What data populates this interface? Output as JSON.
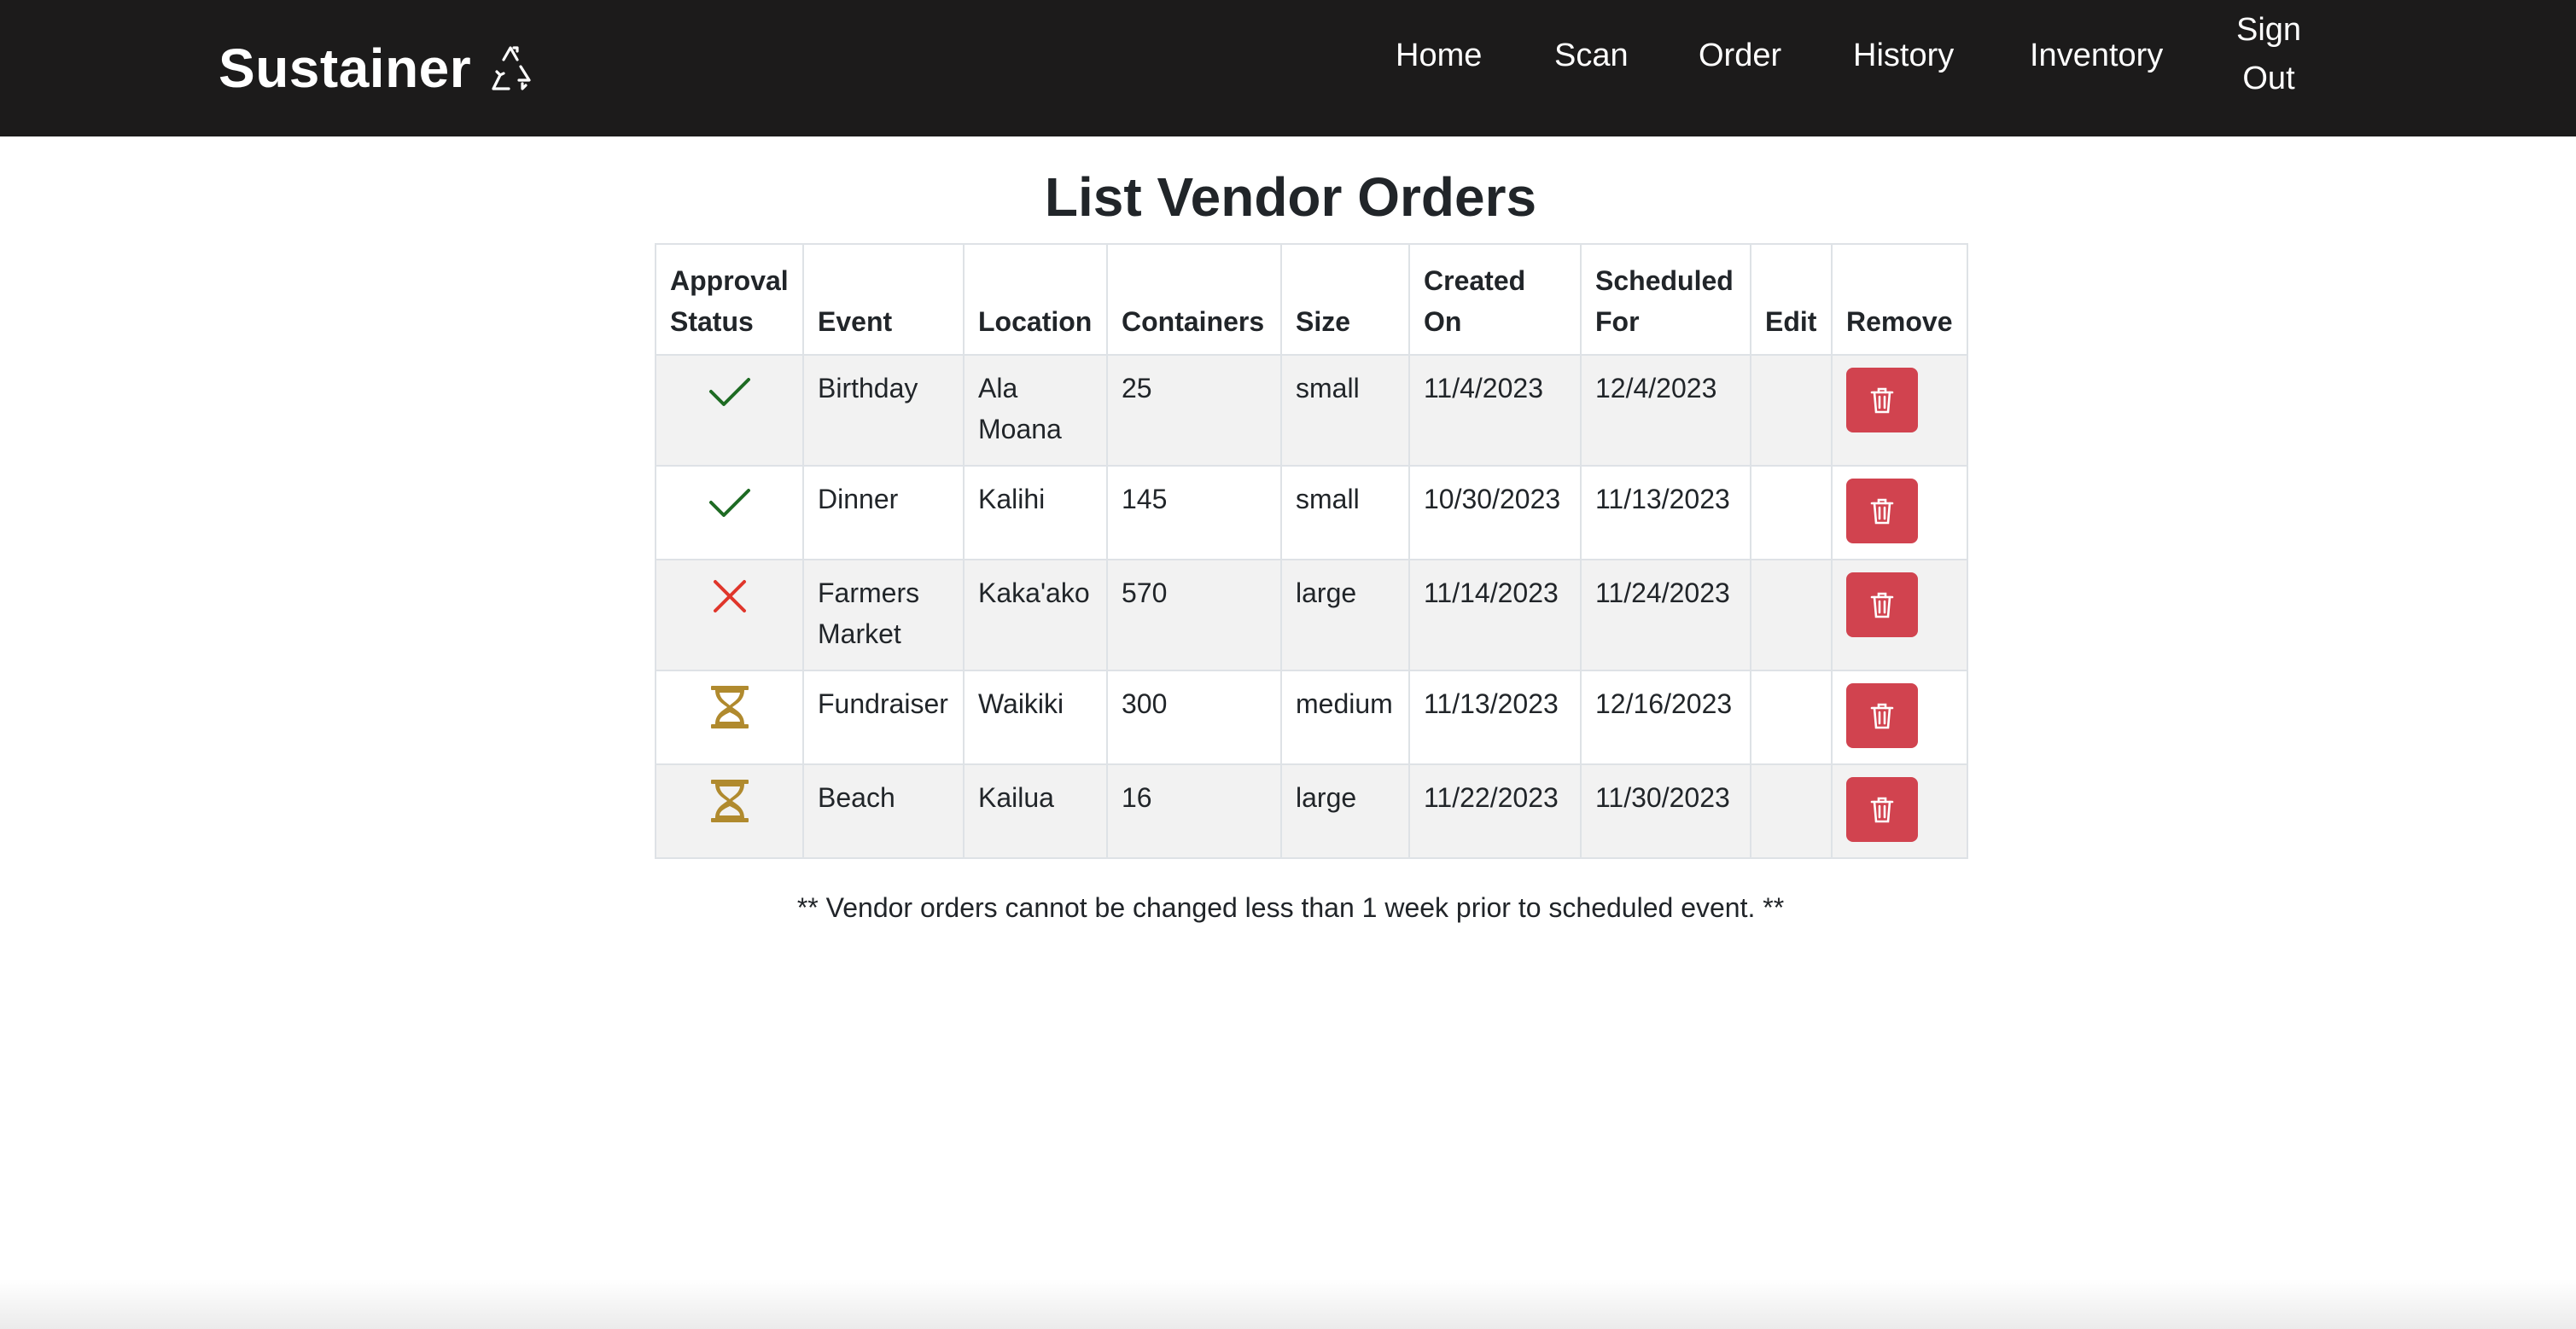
{
  "navbar": {
    "brand": "Sustainer",
    "brand_icon": "recycle-icon",
    "links": {
      "home": "Home",
      "scan": "Scan",
      "order": "Order",
      "history": "History",
      "inventory": "Inventory"
    },
    "signout_line1": "Sign",
    "signout_line2": "Out",
    "background": "#1c1b1b"
  },
  "page": {
    "title": "List Vendor Orders",
    "footnote": "** Vendor orders cannot be changed less than 1 week prior to scheduled event. **"
  },
  "table": {
    "headers": {
      "approval_line1": "Approval",
      "approval_line2": "Status",
      "event": "Event",
      "location": "Location",
      "containers": "Containers",
      "size": "Size",
      "created_line1": "Created",
      "created_line2": "On",
      "scheduled_line1": "Scheduled",
      "scheduled_line2": "For",
      "edit": "Edit",
      "remove": "Remove"
    },
    "rows": [
      {
        "status": "approved",
        "status_icon": "check-icon",
        "event": "Birthday",
        "location": "Ala Moana",
        "containers": "25",
        "size": "small",
        "created": "11/4/2023",
        "scheduled": "12/4/2023"
      },
      {
        "status": "approved",
        "status_icon": "check-icon",
        "event": "Dinner",
        "location": "Kalihi",
        "containers": "145",
        "size": "small",
        "created": "10/30/2023",
        "scheduled": "11/13/2023"
      },
      {
        "status": "rejected",
        "status_icon": "x-icon",
        "event": "Farmers Market",
        "location": "Kaka'ako",
        "containers": "570",
        "size": "large",
        "created": "11/14/2023",
        "scheduled": "11/24/2023"
      },
      {
        "status": "pending",
        "status_icon": "hourglass-icon",
        "event": "Fundraiser",
        "location": "Waikiki",
        "containers": "300",
        "size": "medium",
        "created": "11/13/2023",
        "scheduled": "12/16/2023"
      },
      {
        "status": "pending",
        "status_icon": "hourglass-icon",
        "event": "Beach",
        "location": "Kailua",
        "containers": "16",
        "size": "large",
        "created": "11/22/2023",
        "scheduled": "11/30/2023"
      }
    ],
    "remove_icon": "trash-icon"
  },
  "colors": {
    "approved": "#1e6b23",
    "rejected": "#e0362b",
    "pending": "#b08a2e",
    "remove_button": "#d1434f"
  }
}
